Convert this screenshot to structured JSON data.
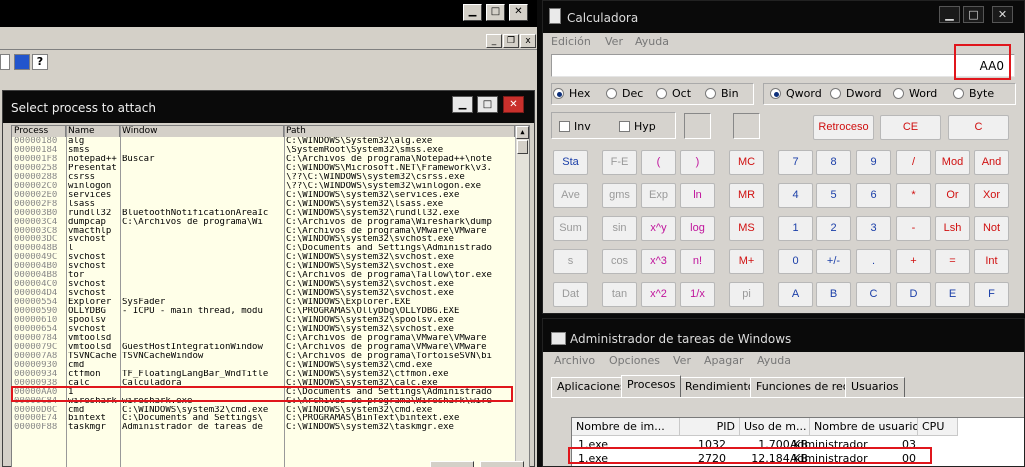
{
  "debugger": {
    "dialog_title": "Select process to attach",
    "toolbar_help_label": "?",
    "columns": [
      "Process",
      "Name",
      "Window",
      "Path"
    ],
    "processes": [
      {
        "pid": "00000180",
        "name": "alg",
        "window": "",
        "path": "C:\\WINDOWS\\System32\\alg.exe"
      },
      {
        "pid": "00000184",
        "name": "smss",
        "window": "",
        "path": "\\SystemRoot\\System32\\smss.exe"
      },
      {
        "pid": "000001F8",
        "name": "notepad++",
        "window": "Buscar",
        "path": "C:\\Archivos de programa\\Notepad++\\note"
      },
      {
        "pid": "00000258",
        "name": "Presentat",
        "window": "",
        "path": "C:\\WINDOWS\\Microsoft.NET\\Framework\\v3."
      },
      {
        "pid": "00000288",
        "name": "csrss",
        "window": "",
        "path": "\\??\\C:\\WINDOWS\\system32\\csrss.exe"
      },
      {
        "pid": "000002C0",
        "name": "winlogon",
        "window": "",
        "path": "\\??\\C:\\WINDOWS\\system32\\winlogon.exe"
      },
      {
        "pid": "000002E0",
        "name": "services",
        "window": "",
        "path": "C:\\WINDOWS\\system32\\services.exe"
      },
      {
        "pid": "000002F8",
        "name": "lsass",
        "window": "",
        "path": "C:\\WINDOWS\\system32\\lsass.exe"
      },
      {
        "pid": "000003B0",
        "name": "rundll32",
        "window": "BluetoothNotificationAreaIc",
        "path": "C:\\WINDOWS\\system32\\rundll32.exe"
      },
      {
        "pid": "000003C4",
        "name": "dumpcap",
        "window": "C:\\Archivos de programa\\Wi",
        "path": "C:\\Archivos de programa\\Wireshark\\dump"
      },
      {
        "pid": "000003C8",
        "name": "vmacthlp",
        "window": "",
        "path": "C:\\Archivos de programa\\VMware\\VMware"
      },
      {
        "pid": "000003DC",
        "name": "svchost",
        "window": "",
        "path": "C:\\WINDOWS\\system32\\svchost.exe"
      },
      {
        "pid": "0000048B",
        "name": "l",
        "window": "",
        "path": "C:\\Documents and Settings\\Administrado"
      },
      {
        "pid": "0000049C",
        "name": "svchost",
        "window": "",
        "path": "C:\\WINDOWS\\system32\\svchost.exe"
      },
      {
        "pid": "000004B0",
        "name": "svchost",
        "window": "",
        "path": "C:\\WINDOWS\\System32\\svchost.exe"
      },
      {
        "pid": "000004B8",
        "name": "tor",
        "window": "",
        "path": "C:\\Archivos de programa\\Tallow\\tor.exe"
      },
      {
        "pid": "000004C0",
        "name": "svchost",
        "window": "",
        "path": "C:\\WINDOWS\\system32\\svchost.exe"
      },
      {
        "pid": "000004D4",
        "name": "svchost",
        "window": "",
        "path": "C:\\WINDOWS\\system32\\svchost.exe"
      },
      {
        "pid": "00000554",
        "name": "Explorer",
        "window": "SysFader",
        "path": "C:\\WINDOWS\\Explorer.EXE"
      },
      {
        "pid": "00000590",
        "name": "OLLYDBG",
        "window": "- ICPU - main thread, modu",
        "path": "C:\\PROGRAMAS\\OllyDbg\\OLLYDBG.EXE"
      },
      {
        "pid": "00000610",
        "name": "spoolsv",
        "window": "",
        "path": "C:\\WINDOWS\\system32\\spoolsv.exe"
      },
      {
        "pid": "00000654",
        "name": "svchost",
        "window": "",
        "path": "C:\\WINDOWS\\system32\\svchost.exe"
      },
      {
        "pid": "00000784",
        "name": "vmtoolsd",
        "window": "",
        "path": "C:\\Archivos de programa\\VMware\\VMware"
      },
      {
        "pid": "0000079C",
        "name": "vmtoolsd",
        "window": "GuestHostIntegrationWindow",
        "path": "C:\\Archivos de programa\\VMware\\VMware"
      },
      {
        "pid": "000007A8",
        "name": "TSVNCache",
        "window": "TSVNCacheWindow",
        "path": "C:\\Archivos de programa\\TortoiseSVN\\bi"
      },
      {
        "pid": "00000930",
        "name": "cmd",
        "window": "",
        "path": "C:\\WINDOWS\\system32\\cmd.exe"
      },
      {
        "pid": "00000934",
        "name": "ctfmon",
        "window": "TF_FloatingLangBar_WndTitle",
        "path": "C:\\WINDOWS\\system32\\ctfmon.exe"
      },
      {
        "pid": "00000938",
        "name": "calc",
        "window": "Calculadora",
        "path": "C:\\WINDOWS\\system32\\calc.exe"
      },
      {
        "pid": "00000AA0",
        "name": "1",
        "window": "",
        "path": "C:\\Documents and Settings\\Administrado"
      },
      {
        "pid": "00000C84",
        "name": "wireshark",
        "window": "wireshark.exe",
        "path": "C:\\Archivos de programa\\Wireshark\\wire"
      },
      {
        "pid": "00000D0C",
        "name": "cmd",
        "window": "C:\\WINDOWS\\system32\\cmd.exe",
        "path": "C:\\WINDOWS\\system32\\cmd.exe"
      },
      {
        "pid": "00000E74",
        "name": "bintext",
        "window": "C:\\Documents and Settings\\",
        "path": "C:\\PROGRAMAS\\BinText\\bintext.exe"
      },
      {
        "pid": "00000F88",
        "name": "taskmgr",
        "window": "Administrador de tareas de",
        "path": "C:\\WINDOWS\\system32\\taskmgr.exe"
      }
    ]
  },
  "calculator": {
    "title": "Calculadora",
    "menu": [
      "Edición",
      "Ver",
      "Ayuda"
    ],
    "display": "AA0",
    "base_modes": [
      {
        "label": "Hex",
        "selected": true
      },
      {
        "label": "Dec",
        "selected": false
      },
      {
        "label": "Oct",
        "selected": false
      },
      {
        "label": "Bin",
        "selected": false
      }
    ],
    "word_modes": [
      {
        "label": "Qword",
        "selected": true
      },
      {
        "label": "Dword",
        "selected": false
      },
      {
        "label": "Word",
        "selected": false
      },
      {
        "label": "Byte",
        "selected": false
      }
    ],
    "checkboxes": [
      "Inv",
      "Hyp"
    ],
    "top_keys": [
      "Retroceso",
      "CE",
      "C"
    ],
    "keys": [
      [
        "Sta",
        "F-E",
        "(",
        ")",
        "MC",
        "7",
        "8",
        "9",
        "/",
        "Mod",
        "And"
      ],
      [
        "Ave",
        "gms",
        "Exp",
        "ln",
        "MR",
        "4",
        "5",
        "6",
        "*",
        "Or",
        "Xor"
      ],
      [
        "Sum",
        "sin",
        "x^y",
        "log",
        "MS",
        "1",
        "2",
        "3",
        "-",
        "Lsh",
        "Not"
      ],
      [
        "s",
        "cos",
        "x^3",
        "n!",
        "M+",
        "0",
        "+/-",
        ".",
        "+",
        "=",
        "Int"
      ],
      [
        "Dat",
        "tan",
        "x^2",
        "1/x",
        "pi",
        "A",
        "B",
        "C",
        "D",
        "E",
        "F"
      ]
    ],
    "key_colors": {
      "blue": "#1a3ea8",
      "red": "#d01010",
      "magenta": "#c0149c",
      "disabled": "#9a9a9a"
    }
  },
  "task_manager": {
    "title": "Administrador de tareas de Windows",
    "menu": [
      "Archivo",
      "Opciones",
      "Ver",
      "Apagar",
      "Ayuda"
    ],
    "tabs": [
      "Aplicaciones",
      "Procesos",
      "Rendimiento",
      "Funciones de red",
      "Usuarios"
    ],
    "active_tab": "Procesos",
    "columns": [
      "Nombre de im...",
      "PID",
      "Uso de m...",
      "Nombre de usuario",
      "CPU"
    ],
    "rows": [
      {
        "image": "1.exe",
        "pid": "1032",
        "mem": "1.700 KB",
        "user": "Administrador",
        "cpu": "03"
      },
      {
        "image": "1.exe",
        "pid": "2720",
        "mem": "12.184 KB",
        "user": "Administrador",
        "cpu": "00"
      }
    ]
  },
  "highlight_color": "#e0161c"
}
